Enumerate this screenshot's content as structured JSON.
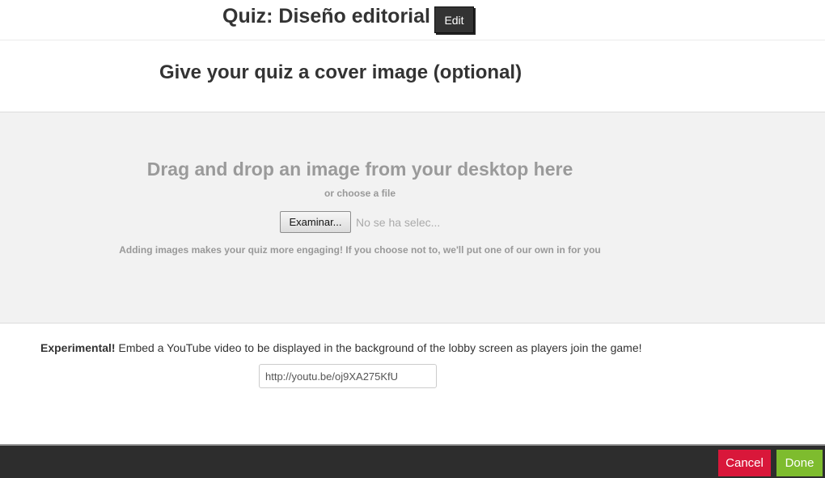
{
  "header": {
    "quiz_title": "Quiz: Diseño editorial",
    "edit_label": "Edit"
  },
  "cover": {
    "heading": "Give your quiz a cover image (optional)"
  },
  "dropzone": {
    "title": "Drag and drop an image from your desktop here",
    "choose_file": "or choose a file",
    "browse_label": "Examinar...",
    "file_status": "No se ha selec...",
    "hint": "Adding images makes your quiz more engaging! If you choose not to, we'll put one of our own in for you"
  },
  "youtube": {
    "strong_label": "Experimental!",
    "description": " Embed a YouTube video to be displayed in the background of the lobby screen as players join the game!",
    "url_value": "http://youtu.be/oj9XA275KfU"
  },
  "footer": {
    "cancel_label": "Cancel",
    "done_label": "Done"
  },
  "colors": {
    "cancel": "#d9173a",
    "done": "#7ebc2e",
    "footer_bg": "#2d2d2d",
    "dropzone_bg": "#f2f2f2"
  }
}
